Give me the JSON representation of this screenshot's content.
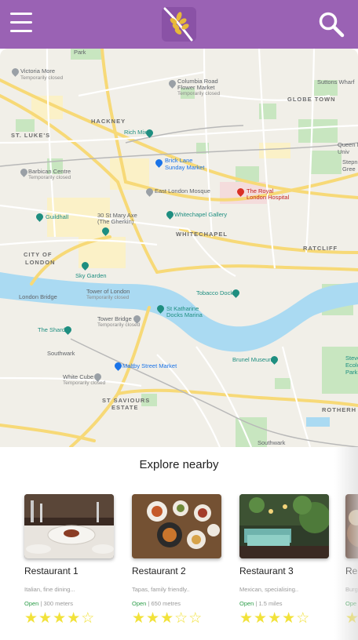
{
  "header": {
    "menu_icon": "hamburger-menu-icon",
    "logo_icon": "wheat-logo-icon",
    "search_icon": "search-icon",
    "background_color": "#9a62b4"
  },
  "map": {
    "labels": {
      "park": "Park",
      "victoria_more": "Victoria More",
      "victoria_more_sub": "Temporarily closed",
      "columbia_road": "Columbia Road",
      "columbia_road_2": "Flower Market",
      "columbia_road_sub": "Temporarily closed",
      "suttons_wharf": "Suttons Wharf",
      "globe_town": "GLOBE TOWN",
      "hackney": "HACKNEY",
      "rich_mix": "Rich Mix",
      "st_lukes": "ST. LUKE'S",
      "queen_m": "Queen M",
      "queen_m_2": "Univ",
      "brick_lane": "Brick Lane",
      "brick_lane_2": "Sunday Market",
      "barbican": "Barbican Centre",
      "barbican_sub": "Temporarily closed",
      "stepney": "Stepney",
      "stepney_2": "Gree",
      "east_london_mosque": "East London Mosque",
      "royal_london": "The Royal",
      "royal_london_2": "London Hospital",
      "guildhall": "Guildhall",
      "st_mary_axe": "30 St Mary Axe",
      "st_mary_axe_2": "(The Gherkin)",
      "whitechapel_gallery": "Whitechapel Gallery",
      "whitechapel": "WHITECHAPEL",
      "city_of_london": "CITY OF",
      "city_of_london_2": "LONDON",
      "ratcliff": "RATCLIFF",
      "sky_garden": "Sky Garden",
      "tower_of_london": "Tower of London",
      "tower_of_london_sub": "Temporarily closed",
      "tobacco_dock": "Tobacco Dock",
      "london_bridge": "London Bridge",
      "st_katharine": "St Katharine",
      "st_katharine_2": "Docks Marina",
      "tower_bridge": "Tower Bridge",
      "tower_bridge_sub": "Temporarily closed",
      "the_shard": "The Shard",
      "southwark": "Southwark",
      "brunel_museum": "Brunel Museum",
      "steve": "Steve",
      "steve_2": "Ecolo",
      "steve_3": "Park",
      "white_cube": "White Cube",
      "white_cube_sub": "Temporarily closed",
      "maltby": "Maltby Street Market",
      "st_saviours": "ST SAVIOURS",
      "st_saviours_2": "ESTATE",
      "rotherh": "ROTHERH",
      "southwark_park": "Southwark"
    }
  },
  "explore": {
    "title": "Explore nearby",
    "cards": [
      {
        "name": "Restaurant 1",
        "description": "Italian, fine dining...",
        "status": "Open",
        "distance": "300 meters",
        "rating": 4,
        "max_rating": 5
      },
      {
        "name": "Restaurant 2",
        "description": "Tapas, family friendly..",
        "status": "Open",
        "distance": "650 metres",
        "rating": 3,
        "max_rating": 5
      },
      {
        "name": "Restaurant 3",
        "description": "Mexican, specialising..",
        "status": "Open",
        "distance": "1.5 miles",
        "rating": 4,
        "max_rating": 5
      },
      {
        "name": "Res",
        "description": "Burg",
        "status": "Ope",
        "distance": "",
        "rating": 1,
        "max_rating": 1
      }
    ]
  }
}
